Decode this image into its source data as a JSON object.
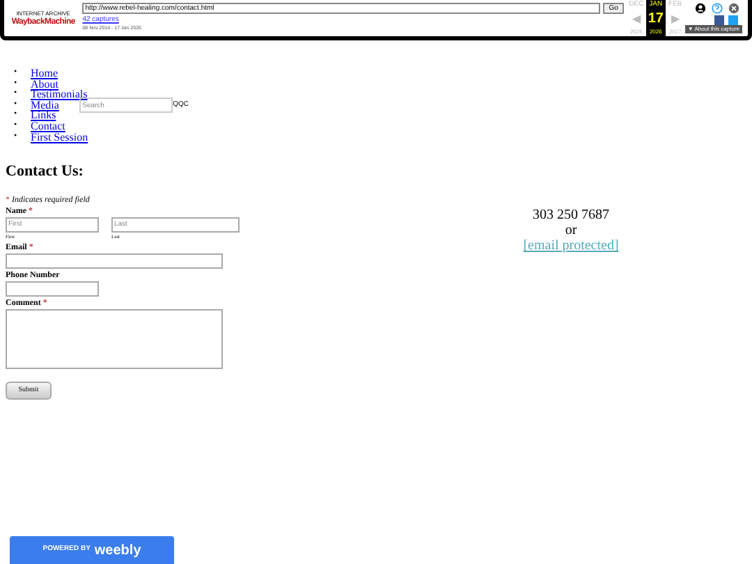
{
  "wayback": {
    "logo_top": "INTERNET ARCHIVE",
    "logo_main": "WaybackMachine",
    "url": "http://www.rebel-healing.com/contact.html",
    "go": "Go",
    "captures": "42 captures",
    "range": "08 Nov 2014 - 17 Jan 2026",
    "months": [
      {
        "month": "DEC",
        "arrow": "◀",
        "year": "2025",
        "selected": false
      },
      {
        "month": "JAN",
        "day": "17",
        "year": "2026",
        "selected": true
      },
      {
        "month": "FEB",
        "arrow": "▶",
        "year": "2027",
        "selected": false
      }
    ],
    "about_icon": "▼",
    "about": "About this capture"
  },
  "bullet": "•",
  "nav": [
    {
      "label": "Home"
    },
    {
      "label": "About"
    },
    {
      "label": "Testimonials"
    },
    {
      "label": "Media"
    },
    {
      "label": "Links"
    },
    {
      "label": "Contact"
    },
    {
      "label": "First Session"
    }
  ],
  "search": {
    "placeholder": "Search",
    "trailing": "QQC"
  },
  "heading": "Contact Us:",
  "required_mark": "*",
  "required_note": "Indicates required field",
  "name": {
    "label": "Name",
    "required": true,
    "first_placeholder": "First",
    "last_placeholder": "Last",
    "first_caption": "First",
    "last_caption": "Last"
  },
  "fields": [
    {
      "label": "Email",
      "required": true,
      "kind": "wide"
    },
    {
      "label": "Phone Number",
      "required": false,
      "kind": "short"
    },
    {
      "label": "Comment",
      "required": true,
      "kind": "textarea"
    }
  ],
  "submit": "Submit",
  "contact": {
    "phone": "303 250 7687",
    "or": "or",
    "email": "[email protected]"
  },
  "badge": {
    "prefix": "POWERED BY",
    "brand": "weebly"
  }
}
